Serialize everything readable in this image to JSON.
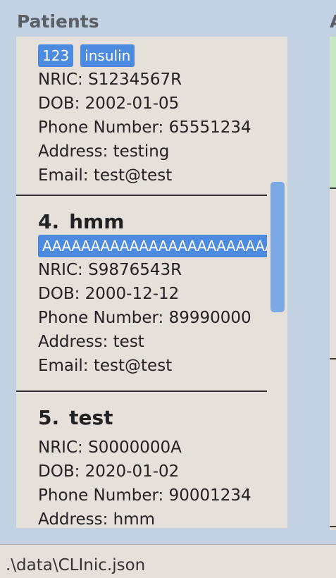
{
  "panel": {
    "title": "Patients",
    "right_title": "A"
  },
  "patients": [
    {
      "tags": [
        "123",
        "insulin"
      ],
      "nric": "NRIC: S1234567R",
      "dob": "DOB: 2002-01-05",
      "phone": "Phone Number: 65551234",
      "address": "Address: testing",
      "email": "Email: test@test"
    },
    {
      "index": "4.",
      "name": "hmm",
      "tags": [
        "AAAAAAAAAAAAAAAAAAAAAAAA"
      ],
      "nric": "NRIC: S9876543R",
      "dob": "DOB: 2000-12-12",
      "phone": "Phone Number: 89990000",
      "address": "Address: test",
      "email": "Email: test@test"
    },
    {
      "index": "5.",
      "name": "test",
      "nric": "NRIC: S0000000A",
      "dob": "DOB: 2020-01-02",
      "phone": "Phone Number: 90001234",
      "address": "Address: hmm"
    }
  ],
  "status_bar": {
    "file_path": ".\\data\\CLInic.json"
  },
  "colors": {
    "tag": "#4c8be0",
    "panel": "#e6e0db",
    "window": "#c3d2e3",
    "scrollbar": "#7aa9e6",
    "accent_green": "#c7e7c5"
  }
}
